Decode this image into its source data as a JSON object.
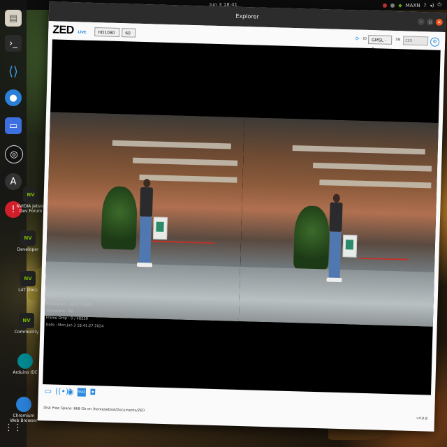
{
  "topbar": {
    "clock": "Jun 3  18:41",
    "power_mode": "MAXN"
  },
  "desktop_icons": [
    {
      "label": "NVIDIA Jetson Dev Forum"
    },
    {
      "label": "Developer"
    },
    {
      "label": "L4T Docs"
    },
    {
      "label": "Community"
    },
    {
      "label": "Arduino IDE"
    },
    {
      "label": "Chromium Web Browser"
    }
  ],
  "window": {
    "title": "Explorer",
    "logo": "ZED",
    "logo_sub": "LIVE",
    "resolution": "HD1080",
    "fps": "60",
    "id_label": "ID",
    "camera_select": "GMSL - 0",
    "sn_label": "SN",
    "sn_placeholder": "ZED",
    "info": {
      "model": "Model : ZED X",
      "resolution": "Resolution : 3840 x 1080",
      "framerate": "Framerate : 60",
      "frame_drop": "Frame Drop : 0 / 48239",
      "date": "Date : Mon Jun 3 18:41:27 2024"
    },
    "status": {
      "disk": "Disk Free Space: 868 Gb  on /home/jetbot/Documents/ZED",
      "version": "v4.0.8"
    }
  }
}
